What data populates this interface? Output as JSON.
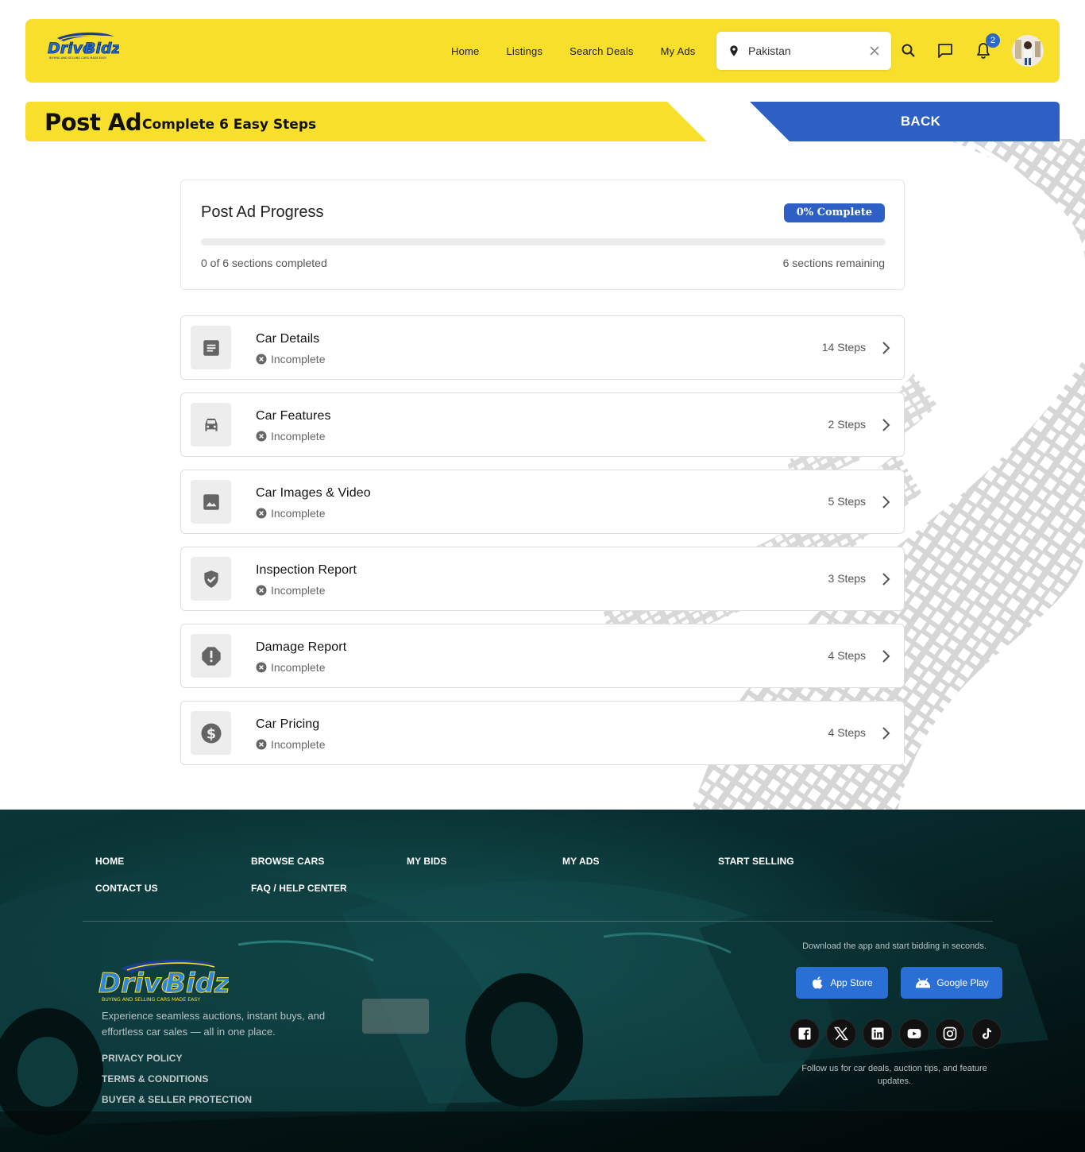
{
  "brand": {
    "name_part1": "Drive",
    "name_part2": "Bidz",
    "tagline": "BUYING AND SELLING CARS MADE EASY",
    "color_primary": "#f7df2c",
    "color_accent": "#2d5fc4"
  },
  "header": {
    "nav": [
      "Home",
      "Listings",
      "Search Deals",
      "My Ads"
    ],
    "location_value": "Pakistan",
    "notifications_count": "2",
    "icons": [
      "location-pin-icon",
      "clear-icon",
      "search-icon",
      "chat-icon",
      "bell-icon"
    ]
  },
  "banner": {
    "title": "Post Ad",
    "subtitle": "Complete 6 Easy Steps",
    "back_label": "BACK"
  },
  "progress": {
    "title": "Post Ad Progress",
    "badge": "0% Complete",
    "fraction": 0,
    "completed_text": "0 of 6 sections completed",
    "remaining_text": "6 sections remaining"
  },
  "sections": [
    {
      "name": "Car Details",
      "status": "Incomplete",
      "steps": "14 Steps",
      "icon": "document-icon"
    },
    {
      "name": "Car Features",
      "status": "Incomplete",
      "steps": "2 Steps",
      "icon": "car-icon"
    },
    {
      "name": "Car Images & Video",
      "status": "Incomplete",
      "steps": "5 Steps",
      "icon": "image-icon"
    },
    {
      "name": "Inspection Report",
      "status": "Incomplete",
      "steps": "3 Steps",
      "icon": "shield-check-icon"
    },
    {
      "name": "Damage Report",
      "status": "Incomplete",
      "steps": "4 Steps",
      "icon": "alert-octagon-icon"
    },
    {
      "name": "Car Pricing",
      "status": "Incomplete",
      "steps": "4 Steps",
      "icon": "dollar-icon"
    }
  ],
  "footer": {
    "nav": {
      "home": "HOME",
      "browse_cars": "BROWSE CARS",
      "my_bids": "MY BIDS",
      "my_ads": "MY ADS",
      "start_selling": "START SELLING",
      "contact_us": "CONTACT US",
      "faq": "FAQ / HELP CENTER"
    },
    "tagline": "Experience seamless auctions, instant buys, and effortless car sales — all in one place.",
    "links": [
      "PRIVACY POLICY",
      "TERMS & CONDITIONS",
      "BUYER & SELLER PROTECTION"
    ],
    "download_text": "Download the app and start bidding in seconds.",
    "app_store": "App Store",
    "google_play": "Google Play",
    "social_icons": [
      "facebook-icon",
      "x-icon",
      "linkedin-icon",
      "youtube-icon",
      "instagram-icon",
      "tiktok-icon"
    ],
    "follow_text": "Follow us for car deals, auction tips, and feature updates."
  }
}
